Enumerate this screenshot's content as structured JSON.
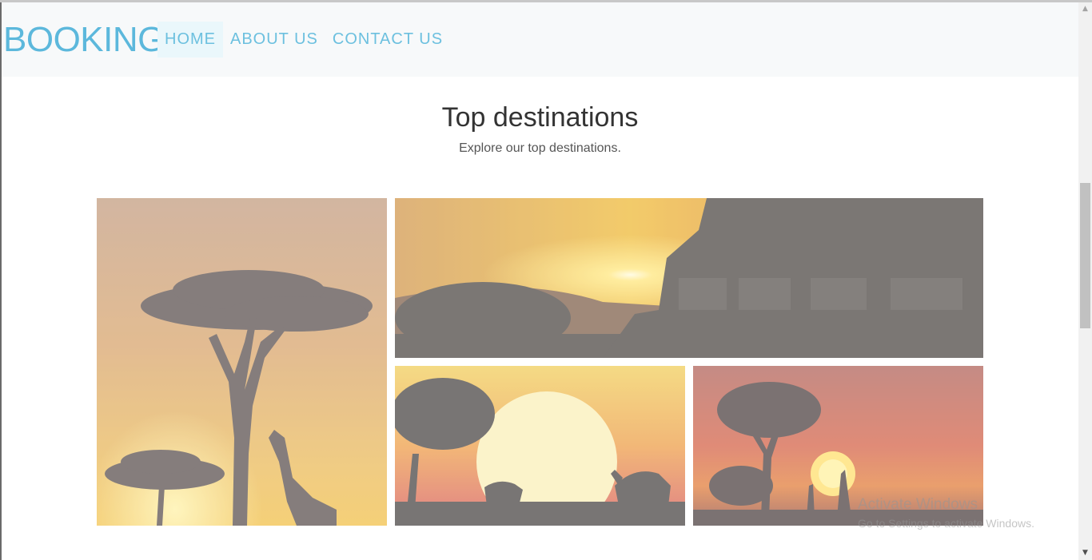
{
  "navbar": {
    "brand": "BOOKING",
    "items": [
      {
        "label": "HOME",
        "active": true
      },
      {
        "label": "ABOUT US",
        "active": false
      },
      {
        "label": "CONTACT US",
        "active": false
      }
    ]
  },
  "section": {
    "title": "Top destinations",
    "subtitle": "Explore our top destinations."
  },
  "gallery": {
    "images": [
      {
        "subject": "giraffe and acacia trees at sunset"
      },
      {
        "subject": "safari jeep with tourists at sunset"
      },
      {
        "subject": "rhino and elephant at sunset"
      },
      {
        "subject": "giraffes and tree under red sky"
      }
    ]
  },
  "watermark": {
    "line1": "Activate Windows",
    "line2": "Go to Settings to activate Windows."
  },
  "colors": {
    "brand": "#5cb8dc",
    "navbar_bg": "#f7f9fa",
    "active_bg": "#eaf7fb"
  }
}
